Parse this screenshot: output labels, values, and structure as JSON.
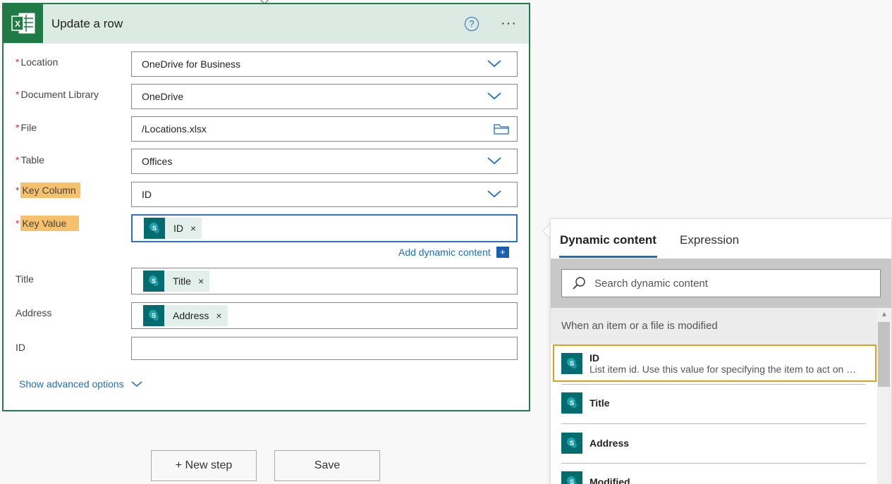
{
  "card": {
    "title": "Update a row",
    "help_icon": "?",
    "more_icon": "···",
    "fields": {
      "location": {
        "label": "Location",
        "value": "OneDrive for Business"
      },
      "document_library": {
        "label": "Document Library",
        "value": "OneDrive"
      },
      "file": {
        "label": "File",
        "value": "/Locations.xlsx"
      },
      "table": {
        "label": "Table",
        "value": "Offices"
      },
      "key_column": {
        "label": "Key Column",
        "value": "ID"
      },
      "key_value": {
        "label": "Key Value",
        "token": "ID"
      },
      "title": {
        "label": "Title",
        "token": "Title"
      },
      "address": {
        "label": "Address",
        "token": "Address"
      },
      "id": {
        "label": "ID",
        "value": ""
      }
    },
    "add_dynamic_content": "Add dynamic content",
    "show_advanced": "Show advanced options",
    "required_mark": "*",
    "token_close": "×"
  },
  "buttons": {
    "new_step": "+ New step",
    "save": "Save"
  },
  "dynamic_panel": {
    "tabs": [
      "Dynamic content",
      "Expression"
    ],
    "search_placeholder": "Search dynamic content",
    "group_heading": "When an item or a file is modified",
    "items": [
      {
        "name": "ID",
        "description": "List item id. Use this value for specifying the item to act on in other actions."
      },
      {
        "name": "Title"
      },
      {
        "name": "Address"
      },
      {
        "name": "Modified"
      }
    ]
  },
  "colors": {
    "excel_green": "#1f7a45",
    "header_bg": "#dbeae3",
    "sharepoint_teal": "#036c70",
    "link_blue": "#1b6ec2",
    "highlight": "#f7c06b",
    "selected_border": "#e0a21b"
  }
}
